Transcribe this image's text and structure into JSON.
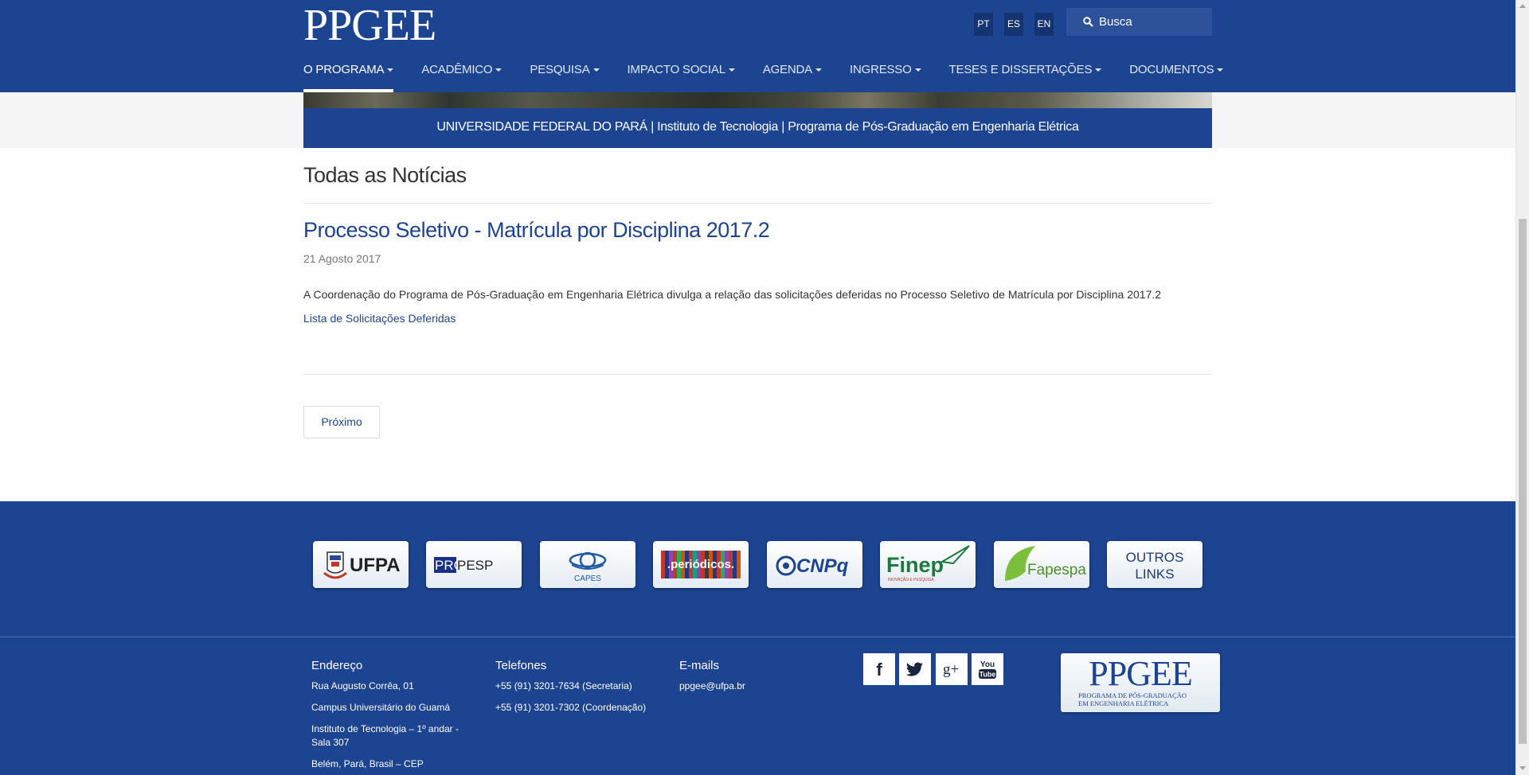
{
  "header": {
    "logo": "PPGEE",
    "languages": [
      "PT",
      "ES",
      "EN"
    ],
    "search_placeholder": "Busca",
    "nav": [
      {
        "label": "O PROGRAMA",
        "active": true
      },
      {
        "label": "ACADÊMICO"
      },
      {
        "label": "PESQUISA"
      },
      {
        "label": "IMPACTO SOCIAL"
      },
      {
        "label": "AGENDA"
      },
      {
        "label": "INGRESSO"
      },
      {
        "label": "TESES E DISSERTAÇÕES"
      },
      {
        "label": "DOCUMENTOS"
      }
    ]
  },
  "banner": {
    "strip_text": "UNIVERSIDADE FEDERAL DO PARÁ | Instituto de Tecnologia | Programa de Pós-Graduação em Engenharia Elétrica"
  },
  "main": {
    "section_title": "Todas as Notícias",
    "article": {
      "title": "Processo Seletivo - Matrícula por Disciplina 2017.2",
      "date": "21 Agosto 2017",
      "body": "A Coordenação do Programa de Pós-Graduação em Engenharia Elétrica divulga a relação das solicitações deferidas no Processo Seletivo de Matrícula por Disciplina 2017.2",
      "link_text": "Lista de Solicitações Deferidas"
    },
    "next_label": "Próximo"
  },
  "partners": {
    "ufpa": "UFPA",
    "propesp_a": "PRO",
    "propesp_b": "PESP",
    "capes": "CAPES",
    "periodicos": ".periódicos.",
    "cnpq": "CNPq",
    "finep": "Finep",
    "finep_sub": "INOVAÇÃO E PESQUISA",
    "fapespa": "Fapespa",
    "outros_1": "OUTROS",
    "outros_2": "LINKS"
  },
  "footer": {
    "address": {
      "heading": "Endereço",
      "lines": [
        "Rua Augusto Corrêa, 01",
        "Campus Universitário do Guamá",
        "Instituto de Tecnologia – 1º andar - Sala 307",
        "Belém, Pará, Brasil – CEP"
      ]
    },
    "phones": {
      "heading": "Telefones",
      "lines": [
        "+55 (91) 3201-7634 (Secretaria)",
        "+55 (91) 3201-7302 (Coordenação)"
      ]
    },
    "emails": {
      "heading": "E-mails",
      "lines": [
        "ppgee@ufpa.br"
      ]
    },
    "social": [
      "facebook-icon",
      "twitter-icon",
      "google-plus-icon",
      "youtube-icon"
    ],
    "social_text": {
      "facebook": "f",
      "google": "g+",
      "youtube_1": "You",
      "youtube_2": "Tube"
    },
    "logo_big": "PPGEE",
    "logo_small_1": "PROGRAMA DE PÓS-GRADUAÇÃO",
    "logo_small_2": "EM ENGENHARIA ELÉTRICA"
  },
  "colors": {
    "brand_blue": "#1d4491",
    "link_blue": "#1d4491"
  }
}
